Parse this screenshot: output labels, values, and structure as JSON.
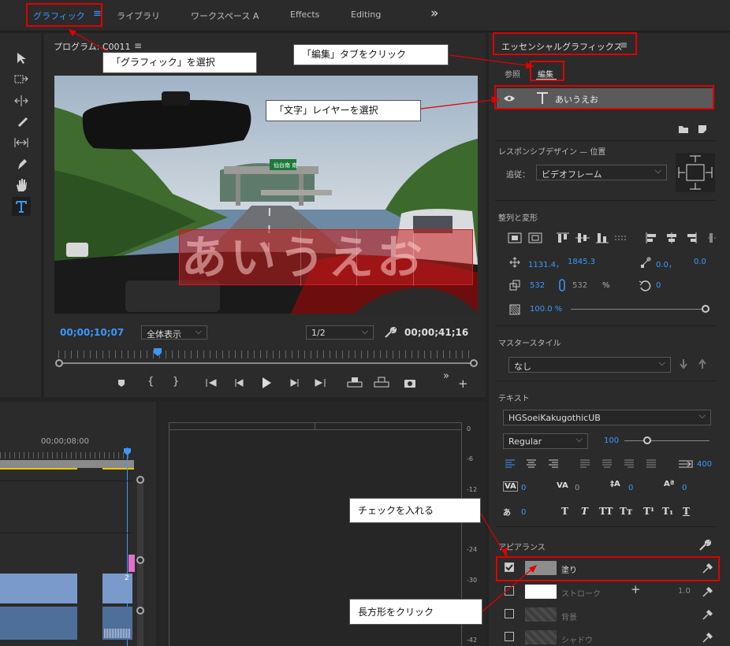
{
  "workspaces": [
    "グラフィック",
    "ライブラリ",
    "ワークスペース A",
    "Effects",
    "Editing"
  ],
  "workspace_menu_glyph": "≡",
  "more_glyph": "»",
  "program": {
    "title": "プログラム: C0011",
    "menu": "≡",
    "timecode": "00;00;10;07",
    "zoom": "全体表示",
    "resolution": "1/2",
    "duration": "00;00;41;16"
  },
  "overlay_text": "あいうえお",
  "sign_text": "仙台南 南",
  "timeline": {
    "ruler_time": "00;00;08:00",
    "track_num": "2"
  },
  "audio_meter": {
    "ticks": [
      "0",
      "-6",
      "-12",
      "-18",
      "-24",
      "-30",
      "-36",
      "-42"
    ]
  },
  "eg": {
    "title": "エッセンシャルグラフィックス",
    "menu": "≡",
    "tabs": [
      "参照",
      "編集"
    ],
    "layer_name": "あいうえお",
    "responsive": {
      "title": "レスポンシブデザイン — 位置",
      "pin_label": "追従：",
      "pin_value": "ビデオフレーム"
    },
    "align": {
      "title": "整列と変形",
      "pos_x": "1131.4，",
      "pos_y": "1845.3",
      "anchor_x": "0.0，",
      "anchor_y": "0.0",
      "scale_w": "532",
      "scale_h": "532",
      "scale_unit": "%",
      "rotation": "0",
      "opacity": "100.0 %"
    },
    "master": {
      "title": "マスタースタイル",
      "value": "なし"
    },
    "text": {
      "title": "テキスト",
      "font": "HGSoeiKakugothicUB",
      "style": "Regular",
      "size": "100",
      "tab_width": "400",
      "kerning": "0",
      "tracking": "0",
      "leading": "0",
      "baseline": "0",
      "tsume": "0",
      "indent": "0",
      "tt_buttons": [
        "T",
        "T",
        "TT",
        "Tт",
        "T¹",
        "T₁",
        "T"
      ]
    },
    "appearance": {
      "title": "アピアランス",
      "fill": "塗り",
      "stroke": "ストローク",
      "stroke_width": "1.0",
      "background": "背景",
      "shadow": "シャドウ"
    }
  },
  "callouts": {
    "graphic": "「グラフィック」を選択",
    "edit_tab": "「編集」タブをクリック",
    "text_layer": "「文字」レイヤーを選択",
    "check": "チェックを入れる",
    "rect": "長方形をクリック"
  },
  "colors": {
    "accent": "#3a98ff",
    "annotation": "#e00000",
    "overlay": "#c81e1e"
  }
}
